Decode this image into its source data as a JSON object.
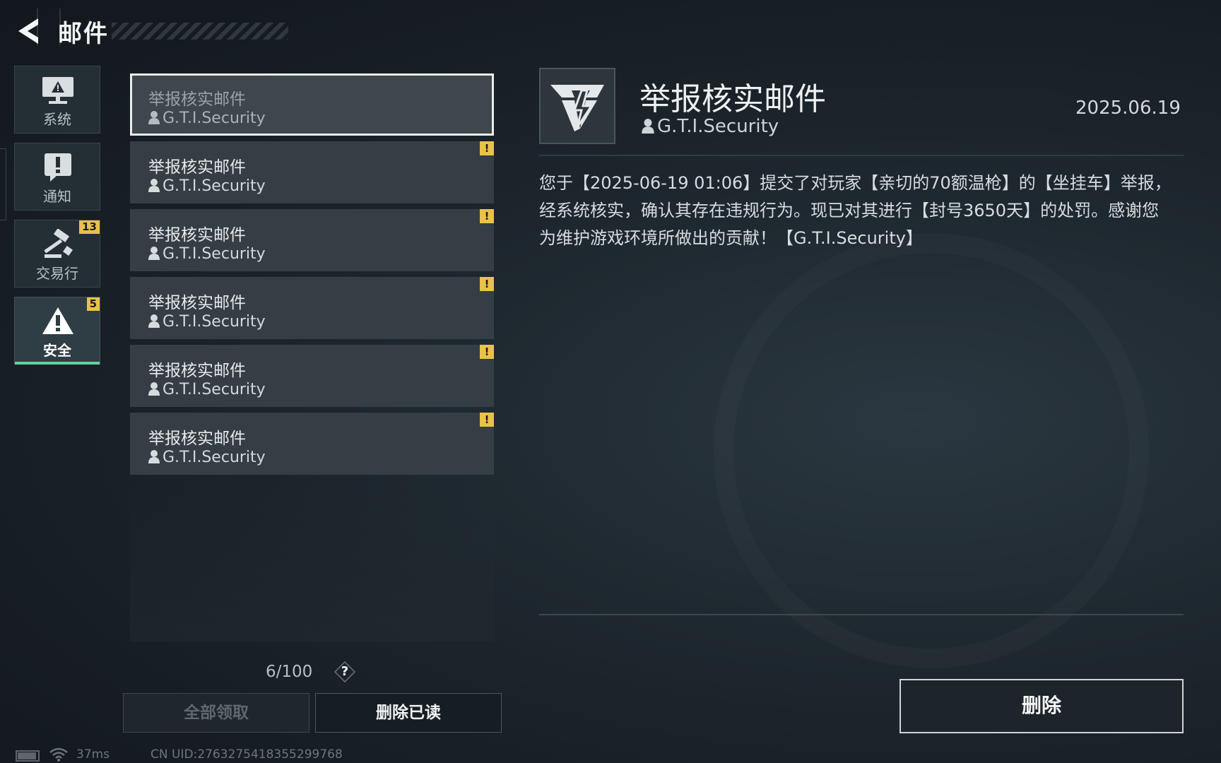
{
  "header": {
    "title": "邮件"
  },
  "sidebar": {
    "tabs": [
      {
        "label": "系统",
        "icon": "monitor-icon",
        "badge": ""
      },
      {
        "label": "通知",
        "icon": "notice-icon",
        "badge": ""
      },
      {
        "label": "交易行",
        "icon": "gavel-icon",
        "badge": "13"
      },
      {
        "label": "安全",
        "icon": "warning-icon",
        "badge": "5",
        "active": true
      }
    ]
  },
  "mail_list": {
    "items": [
      {
        "subject": "举报核实邮件",
        "sender": "G.T.I.Security",
        "unread": false,
        "selected": true
      },
      {
        "subject": "举报核实邮件",
        "sender": "G.T.I.Security",
        "unread": true
      },
      {
        "subject": "举报核实邮件",
        "sender": "G.T.I.Security",
        "unread": true
      },
      {
        "subject": "举报核实邮件",
        "sender": "G.T.I.Security",
        "unread": true
      },
      {
        "subject": "举报核实邮件",
        "sender": "G.T.I.Security",
        "unread": true
      },
      {
        "subject": "举报核实邮件",
        "sender": "G.T.I.Security",
        "unread": true
      }
    ],
    "unread_flag": "!",
    "count": "6/100",
    "help": "?",
    "claim_all_label": "全部领取",
    "delete_read_label": "删除已读"
  },
  "detail": {
    "title": "举报核实邮件",
    "sender": "G.T.I.Security",
    "date": "2025.06.19",
    "body": "您于【2025-06-19 01:06】提交了对玩家【亲切的70额温枪】的【坐挂车】举报，经系统核实，确认其存在违规行为。现已对其进行【封号3650天】的处罚。感谢您为维护游戏环境所做出的贡献！【G.T.I.Security】",
    "delete_label": "删除"
  },
  "footer": {
    "ping": "37ms",
    "uid": "CN UID:2763275418355299768"
  },
  "colors": {
    "accent": "#5fd29a",
    "badge": "#e9c24a"
  }
}
